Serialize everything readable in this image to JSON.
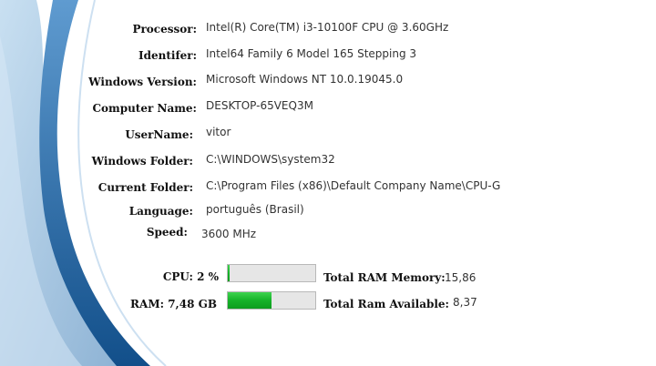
{
  "system_info": {
    "processor_label": "Processor:",
    "processor_value": "Intel(R) Core(TM) i3-10100F CPU @ 3.60GHz",
    "identifier_label": "Identifer:",
    "identifier_value": "Intel64 Family 6 Model 165 Stepping 3",
    "windows_version_label": "Windows Version:",
    "windows_version_value": "Microsoft Windows NT 10.0.19045.0",
    "computer_name_label": "Computer Name:",
    "computer_name_value": "DESKTOP-65VEQ3M",
    "username_label": "UserName:",
    "username_value": "vitor",
    "windows_folder_label": "Windows Folder:",
    "windows_folder_value": "C:\\WINDOWS\\system32",
    "current_folder_label": "Current Folder:",
    "current_folder_value": "C:\\Program Files (x86)\\Default Company Name\\CPU-G",
    "language_label": "Language:",
    "language_value": "português (Brasil)",
    "speed_label": "Speed:",
    "speed_value": "3600 MHz"
  },
  "usage": {
    "cpu_label": "CPU: 2 %",
    "cpu_fraction": 0.02,
    "ram_label": "RAM: 7,48 GB",
    "ram_fraction": 0.5,
    "total_ram_label": "Total RAM Memory:",
    "total_ram_value": "15,86",
    "available_ram_label": "Total Ram Available:",
    "available_ram_value": "8,37"
  },
  "colors": {
    "swoosh_dark": "#1f5f99",
    "swoosh_light": "#7fb2dc",
    "bar_fill": "#16b22a",
    "bar_track": "#e6e6e6"
  }
}
